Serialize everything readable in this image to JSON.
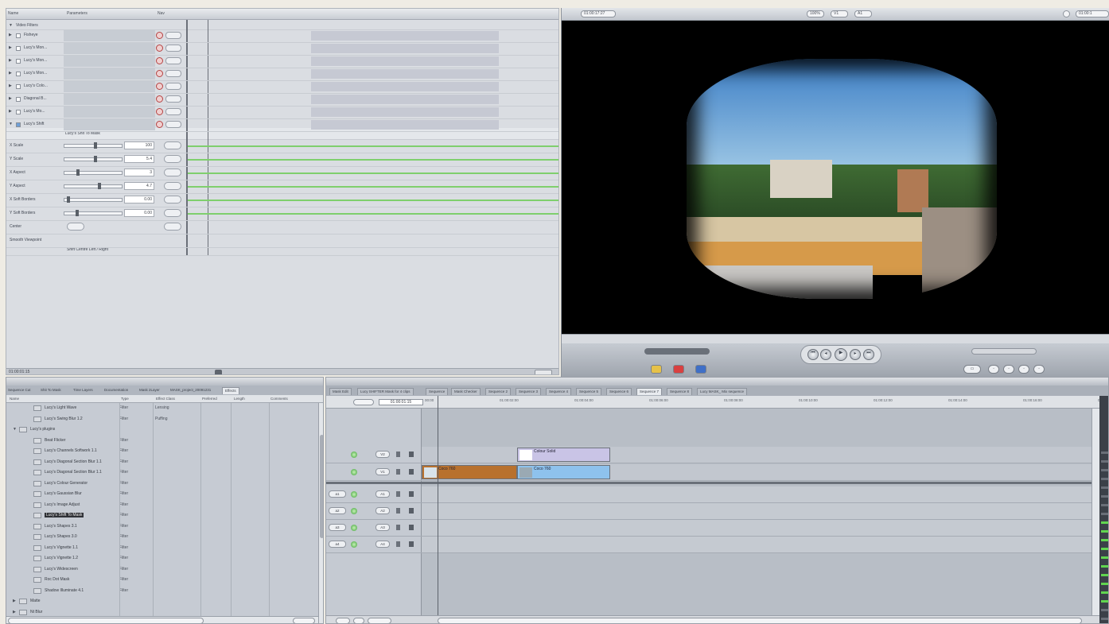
{
  "filters_panel": {
    "header": {
      "name": "Name",
      "parameters": "Parameters",
      "nav": "Nav"
    },
    "filters": [
      {
        "label": "Fisheye",
        "checked": false
      },
      {
        "label": "Lucy's Mon...",
        "checked": false
      },
      {
        "label": "Lucy's Mon...",
        "checked": false
      },
      {
        "label": "Lucy's Mon...",
        "checked": false
      },
      {
        "label": "Lucy's Colo...",
        "checked": false
      },
      {
        "label": "Diagonal B...",
        "checked": false
      },
      {
        "label": "Lucy's Mo...",
        "checked": false
      },
      {
        "label": "Lucy's Shift",
        "checked": true
      }
    ],
    "active_filter_title": "Lucy's Shit To Mask",
    "params": [
      {
        "label": "X Scale",
        "value": "100",
        "knob": 0.55
      },
      {
        "label": "Y Scale",
        "value": "5.4",
        "knob": 0.55
      },
      {
        "label": "X Aspect",
        "value": "3",
        "knob": 0.22
      },
      {
        "label": "Y Aspect",
        "value": "4.7",
        "knob": 0.62
      },
      {
        "label": "X Soft Borders",
        "value": "0.00",
        "knob": 0.05
      },
      {
        "label": "Y Soft Borders",
        "value": "0.00",
        "knob": 0.2
      },
      {
        "label": "Center",
        "value": "",
        "knob": 0.75
      },
      {
        "label": "Smooth Viewpoint",
        "value": "",
        "knob": 0
      }
    ],
    "shift_label": "Shift Centre Left / Right",
    "footer_timecode": "01:00:01:15"
  },
  "viewer": {
    "timecode": "01:00:17:27",
    "zoom": "100%",
    "view_mode": "V1",
    "view_mode2": "A1",
    "right_timecode": "01:00:1"
  },
  "browser": {
    "tabs": [
      "Sequence Cut",
      "Shit To Mask",
      "Time Layers",
      "Documentation",
      "Mask 2Layer",
      "MASK_project_20091231",
      "Effects"
    ],
    "columns": [
      "Name",
      "Type",
      "Effect Class",
      "Preferred",
      "Length",
      "Comments"
    ],
    "items": [
      {
        "name": "Lucy's Light Wave",
        "type": "Filter",
        "extra": "Lensing",
        "indent": 1
      },
      {
        "name": "Lucy's Swing Blur 1.2",
        "type": "Filter",
        "extra": "Puffing",
        "indent": 1
      },
      {
        "name": "Lucy's plugins",
        "type": "",
        "extra": "",
        "indent": 0,
        "folder": true
      },
      {
        "name": "Beat Flicker",
        "type": "Filter",
        "extra": "",
        "indent": 1
      },
      {
        "name": "Lucy's Channels Softwork 1.1",
        "type": "Filter",
        "extra": "",
        "indent": 1
      },
      {
        "name": "Lucy's Diagonal Section Blur 1.1",
        "type": "Filter",
        "extra": "",
        "indent": 1
      },
      {
        "name": "Lucy's Diagonal Section Blur 1.1",
        "type": "Filter",
        "extra": "",
        "indent": 1
      },
      {
        "name": "Lucy's Colour Generator",
        "type": "Filter",
        "extra": "",
        "indent": 1
      },
      {
        "name": "Lucy's Gaussian Blur",
        "type": "Filter",
        "extra": "",
        "indent": 1
      },
      {
        "name": "Lucy's Image Adjust",
        "type": "Filter",
        "extra": "",
        "indent": 1
      },
      {
        "name": "Lucy's Shift To Mask",
        "type": "Filter",
        "extra": "",
        "indent": 1,
        "selected": true
      },
      {
        "name": "Lucy's Shapes 3.1",
        "type": "Filter",
        "extra": "",
        "indent": 1
      },
      {
        "name": "Lucy's Shapes 3.0",
        "type": "Filter",
        "extra": "",
        "indent": 1
      },
      {
        "name": "Lucy's Vignette 1.1",
        "type": "Filter",
        "extra": "",
        "indent": 1
      },
      {
        "name": "Lucy's Vignette 1.2",
        "type": "Filter",
        "extra": "",
        "indent": 1
      },
      {
        "name": "Lucy's Widescreen",
        "type": "Filter",
        "extra": "",
        "indent": 1
      },
      {
        "name": "Roc Dot Mask",
        "type": "Filter",
        "extra": "",
        "indent": 1
      },
      {
        "name": "Shadow Illuminate 4.1",
        "type": "Filter",
        "extra": "",
        "indent": 1
      },
      {
        "name": "Matte",
        "type": "",
        "extra": "",
        "indent": 0,
        "folder": true
      },
      {
        "name": "Nt Blur",
        "type": "",
        "extra": "",
        "indent": 0,
        "folder": true
      }
    ]
  },
  "timeline": {
    "tabs": [
      "Mask Edit",
      "Lucy SHIFTER Mask for 4 clips",
      "Sequence",
      "Mask Checker",
      "Sequence 2",
      "Sequence 3",
      "Sequence 4",
      "Sequence 5",
      "Sequence 6",
      "Sequence 7",
      "Sequence 8",
      "Lucy MASK_ Mix sequence"
    ],
    "active_tab_index": 9,
    "timecode": "01:00:01:15",
    "ruler_ticks": [
      "00:00",
      "01:00:02:00",
      "01:00:04:00",
      "01:00:06:00",
      "01:00:08:00",
      "01:00:10:00",
      "01:00:12:00",
      "01:00:14:00",
      "01:00:16:00",
      "01:00:18:00"
    ],
    "video_tracks": [
      {
        "label": "V2",
        "clips": [
          {
            "label": "Colour Solid",
            "color": "#c9c4e6",
            "thumb": "#ffffff",
            "start": 0.143,
            "end": 0.282
          }
        ]
      },
      {
        "label": "V1",
        "clips": [
          {
            "label": "Coco 760",
            "color": "#b8712e",
            "thumb": "#d8e3ea",
            "start": 0.0,
            "end": 0.142
          },
          {
            "label": "Coco 760",
            "color": "#8ec2ed",
            "thumb": "#9aa9b3",
            "start": 0.143,
            "end": 0.282
          }
        ]
      }
    ],
    "audio_tracks": [
      {
        "patch": "a1",
        "label": "A1"
      },
      {
        "patch": "a2",
        "label": "A2"
      },
      {
        "patch": "a3",
        "label": "A3"
      },
      {
        "patch": "a4",
        "label": "A4"
      }
    ],
    "meter_on": [
      false,
      false,
      false,
      false,
      false,
      false,
      false,
      false,
      true,
      true,
      true,
      true,
      true,
      true,
      true,
      true,
      true,
      true,
      false,
      false
    ]
  }
}
